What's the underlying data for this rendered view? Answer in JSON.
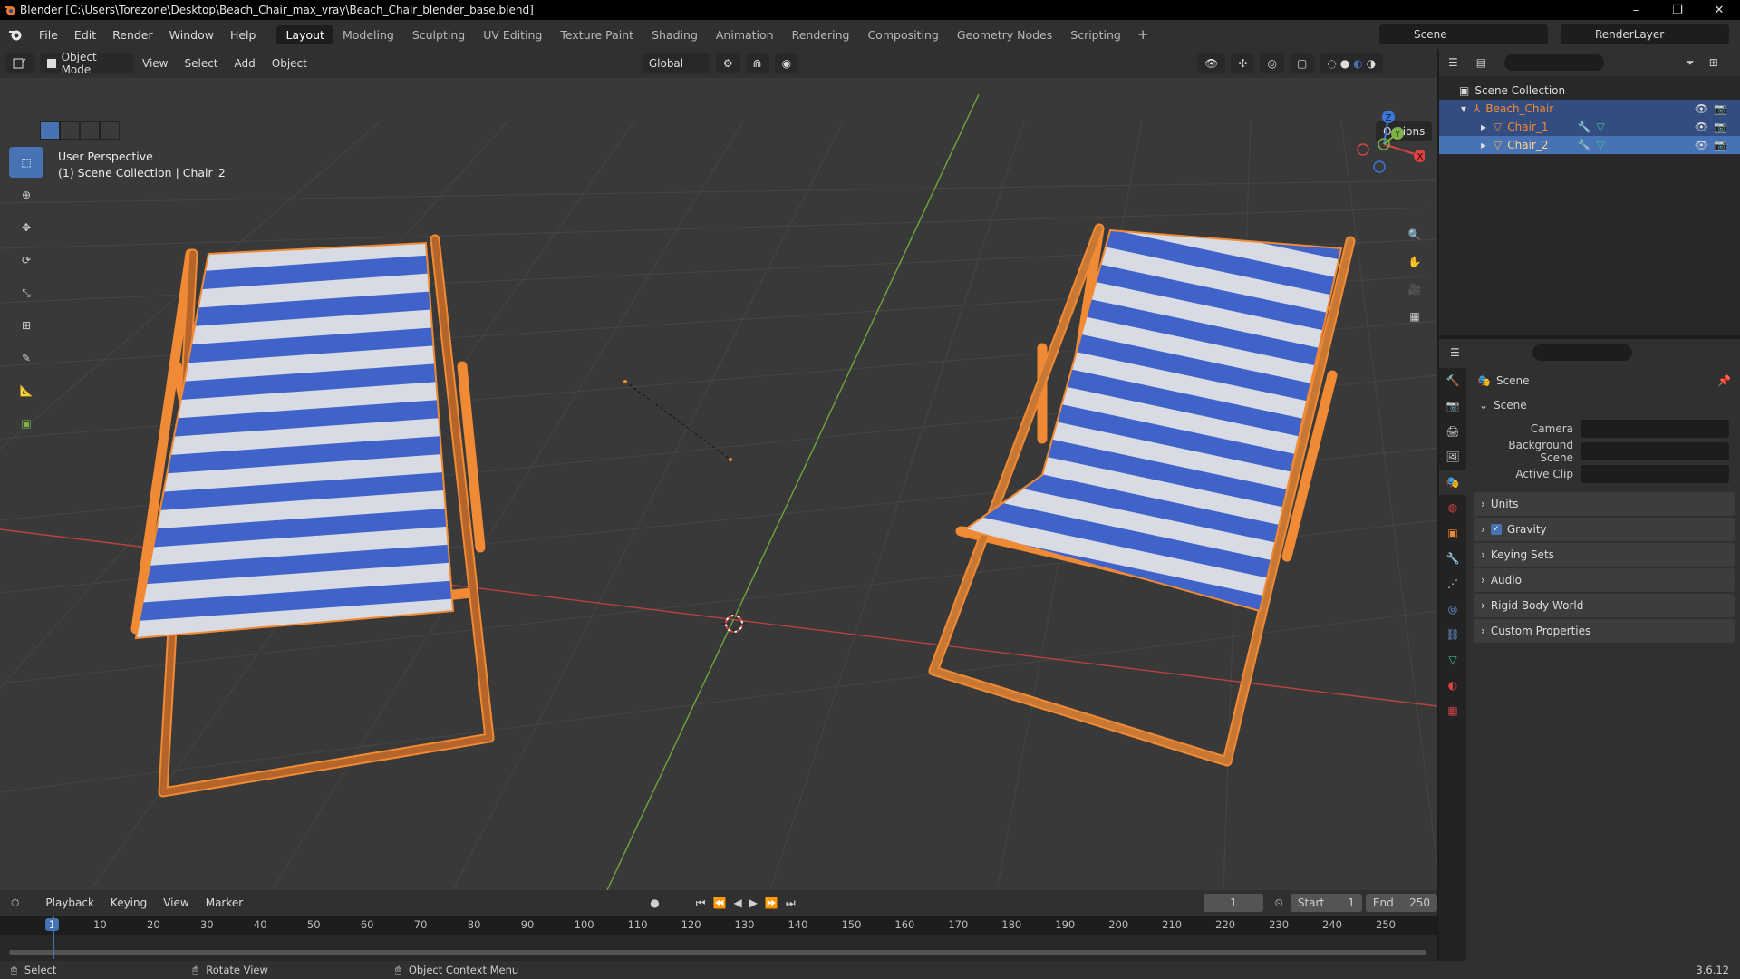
{
  "window": {
    "title": "Blender [C:\\Users\\Torezone\\Desktop\\Beach_Chair_max_vray\\Beach_Chair_blender_base.blend]",
    "minimize": "–",
    "maximize": "❐",
    "close": "✕"
  },
  "menus": [
    "File",
    "Edit",
    "Render",
    "Window",
    "Help"
  ],
  "workspaces": [
    "Layout",
    "Modeling",
    "Sculpting",
    "UV Editing",
    "Texture Paint",
    "Shading",
    "Animation",
    "Rendering",
    "Compositing",
    "Geometry Nodes",
    "Scripting"
  ],
  "active_workspace": "Layout",
  "scene_name": "Scene",
  "render_layer": "RenderLayer",
  "viewport": {
    "mode": "Object Mode",
    "menus": [
      "View",
      "Select",
      "Add",
      "Object"
    ],
    "transform_orientation": "Global",
    "options_label": "Options",
    "perspective": "User Perspective",
    "context": "(1) Scene Collection | Chair_2"
  },
  "gizmo": {
    "z": "Z",
    "y": "Y",
    "x": "X"
  },
  "outliner": {
    "root": "Scene Collection",
    "items": [
      {
        "name": "Beach_Chair",
        "level": 1
      },
      {
        "name": "Chair_1",
        "level": 2
      },
      {
        "name": "Chair_2",
        "level": 2
      }
    ]
  },
  "properties": {
    "header": "Scene",
    "panel": "Scene",
    "fields": [
      {
        "label": "Camera"
      },
      {
        "label": "Background Scene"
      },
      {
        "label": "Active Clip"
      }
    ],
    "collapsed_panels": [
      "Units",
      "Gravity",
      "Keying Sets",
      "Audio",
      "Rigid Body World",
      "Custom Properties"
    ],
    "gravity_checked": true
  },
  "timeline": {
    "menus": [
      "Playback",
      "Keying",
      "View",
      "Marker"
    ],
    "current_frame": "1",
    "start_label": "Start",
    "start": "1",
    "end_label": "End",
    "end": "250",
    "ticks": [
      "1",
      "10",
      "20",
      "30",
      "40",
      "50",
      "60",
      "70",
      "80",
      "90",
      "100",
      "110",
      "120",
      "130",
      "140",
      "150",
      "160",
      "170",
      "180",
      "190",
      "200",
      "210",
      "220",
      "230",
      "240",
      "250"
    ]
  },
  "statusbar": {
    "select": "Select",
    "rotate": "Rotate View",
    "context_menu": "Object Context Menu",
    "version": "3.6.12"
  },
  "colors": {
    "accent": "#4772b3",
    "selection_orange": "#f08a35",
    "stripe_blue": "#3f63c9",
    "x_axis": "#b8433f",
    "y_axis": "#6ea63a"
  }
}
